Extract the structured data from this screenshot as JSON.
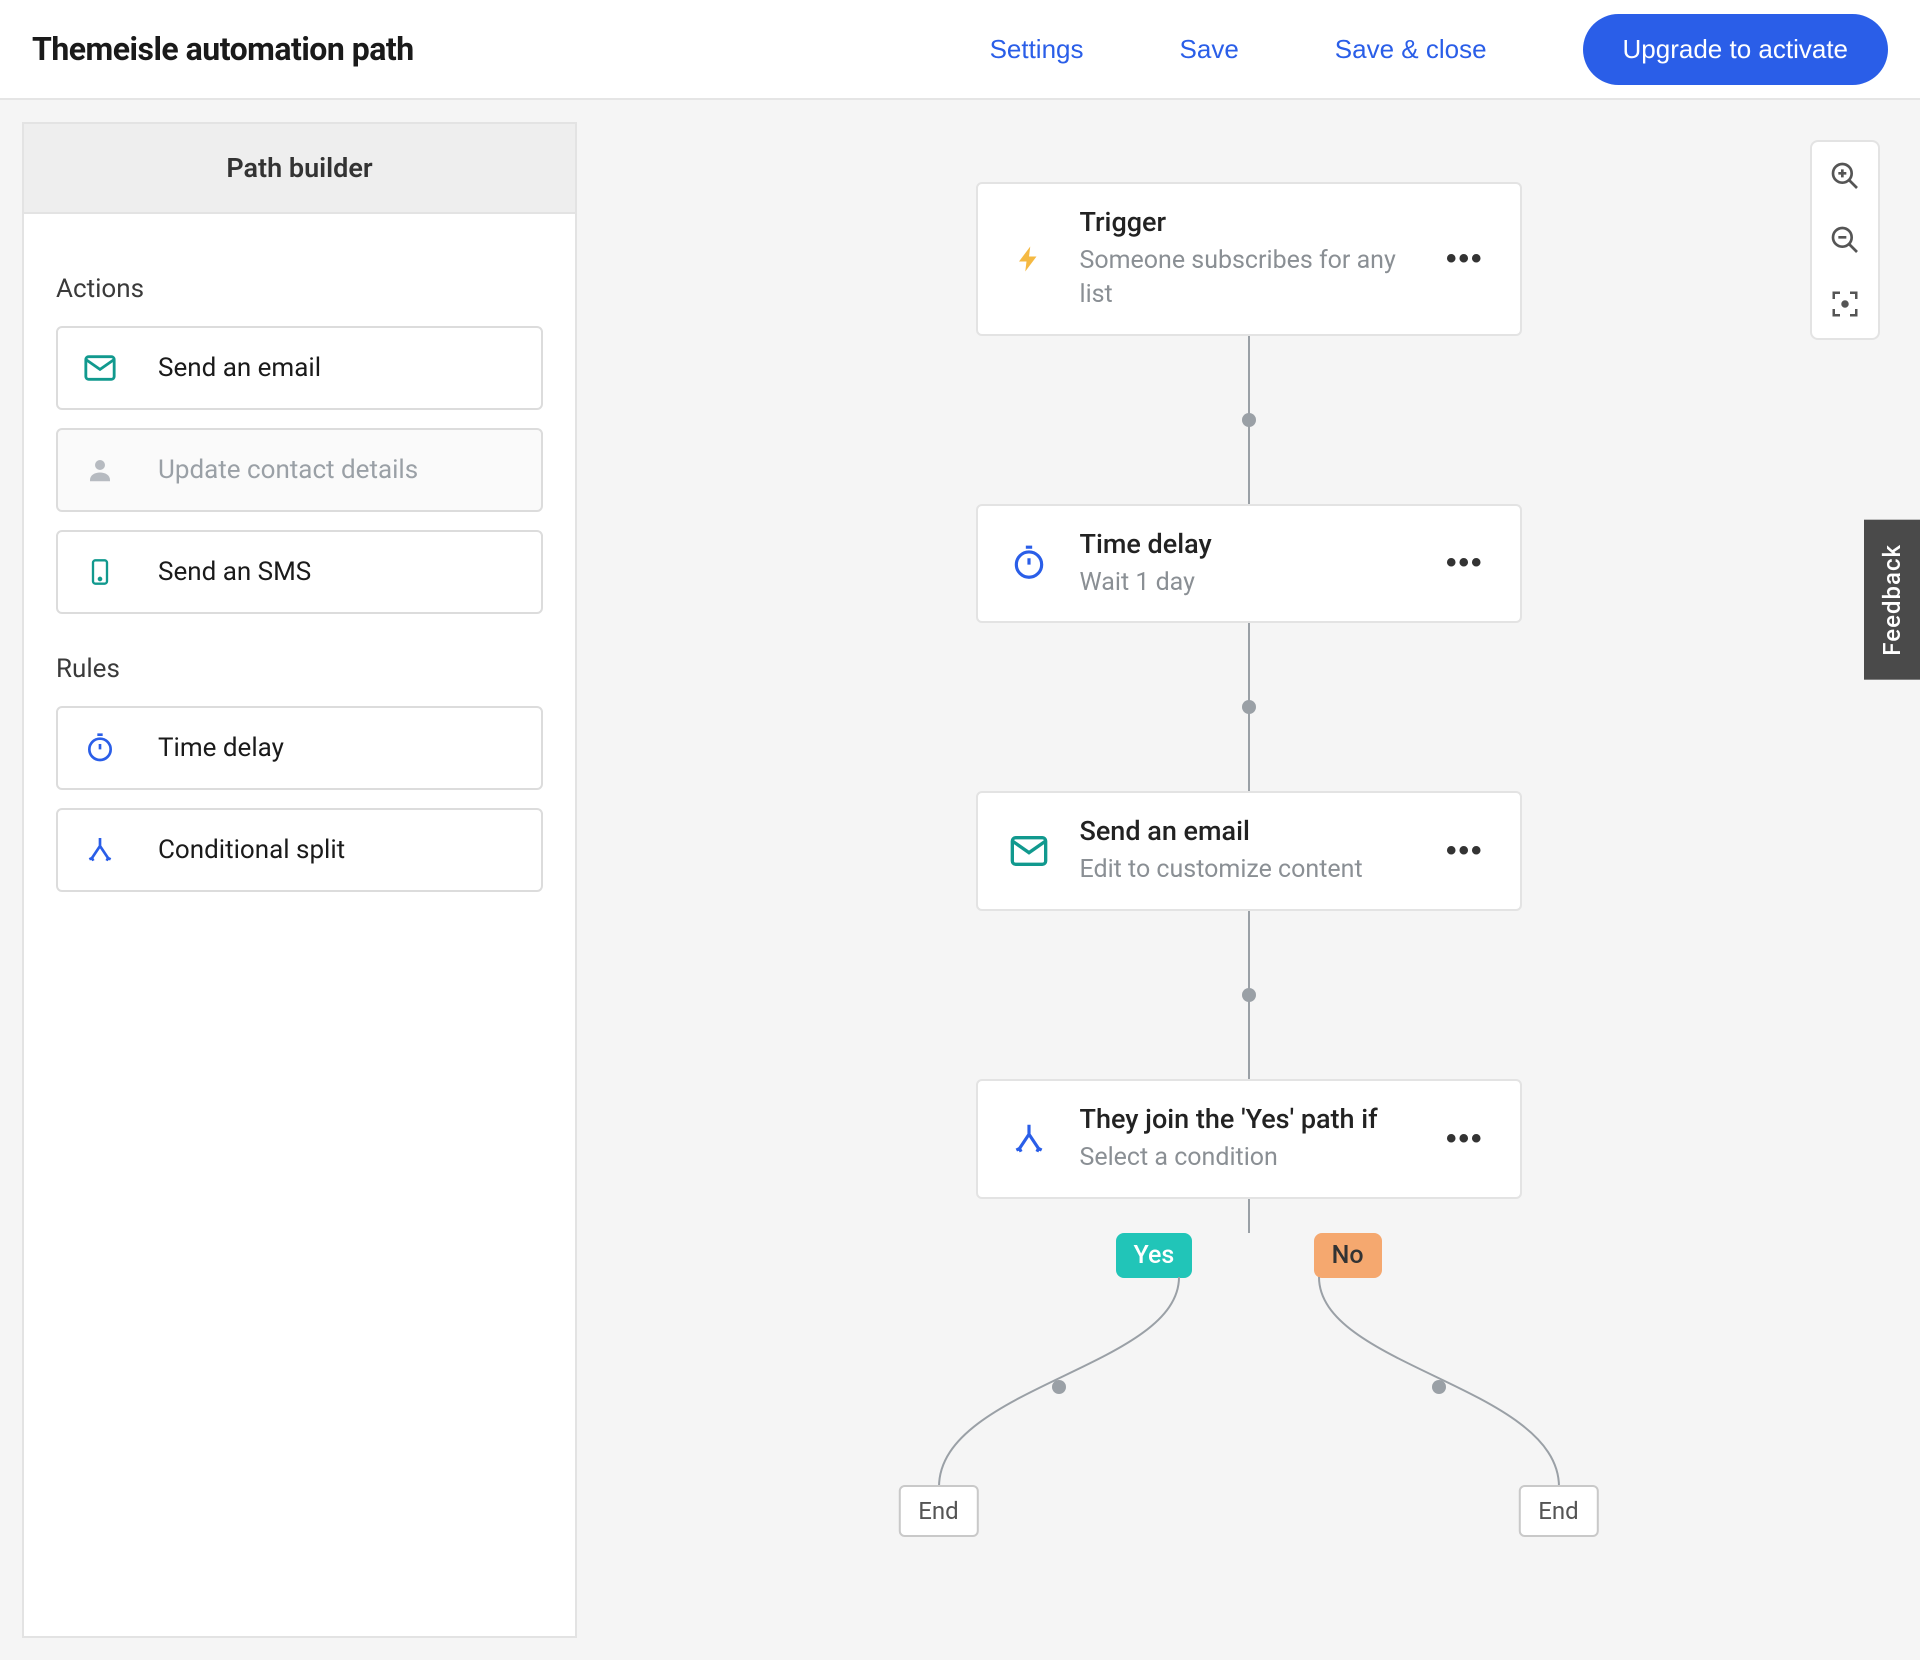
{
  "header": {
    "title": "Themeisle automation path",
    "settings": "Settings",
    "save": "Save",
    "save_close": "Save & close",
    "upgrade": "Upgrade to activate"
  },
  "sidebar": {
    "title": "Path builder",
    "actions_label": "Actions",
    "rules_label": "Rules",
    "actions": [
      {
        "label": "Send an email"
      },
      {
        "label": "Update contact details"
      },
      {
        "label": "Send an SMS"
      }
    ],
    "rules": [
      {
        "label": "Time delay"
      },
      {
        "label": "Conditional split"
      }
    ]
  },
  "flow": {
    "trigger": {
      "title": "Trigger",
      "sub": "Someone subscribes for any list"
    },
    "delay": {
      "title": "Time delay",
      "sub": "Wait 1 day"
    },
    "email": {
      "title": "Send an email",
      "sub": "Edit to customize content"
    },
    "split": {
      "title": "They join the 'Yes' path if",
      "sub": "Select a condition"
    },
    "yes": "Yes",
    "no": "No",
    "end": "End"
  },
  "feedback": "Feedback"
}
